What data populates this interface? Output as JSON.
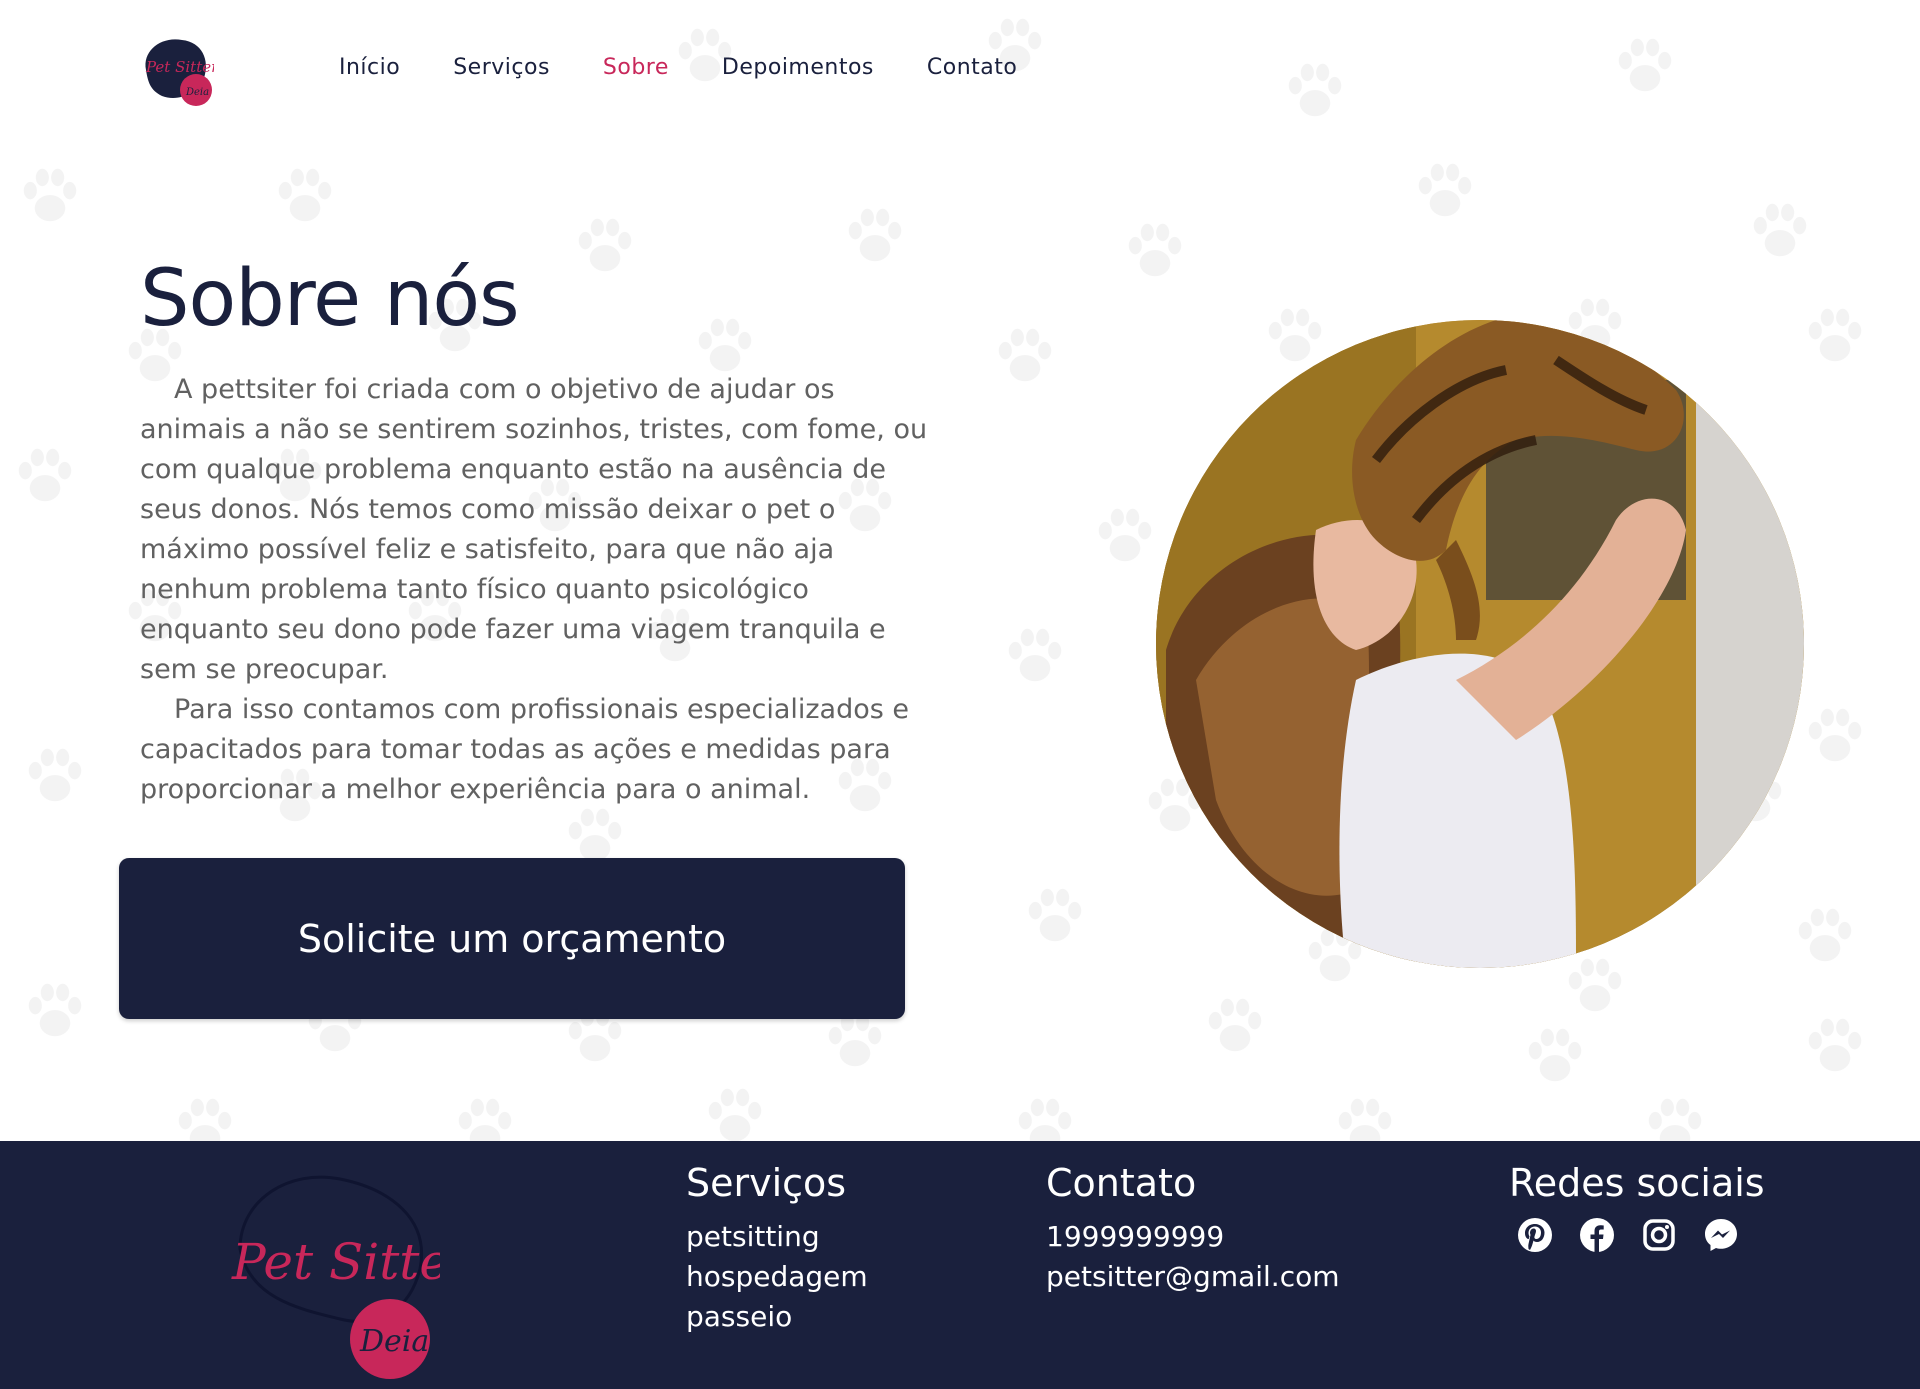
{
  "brand": {
    "logo_text_main": "Pet Sitter",
    "logo_text_sub": "Deia"
  },
  "nav": {
    "items": [
      {
        "label": "Início",
        "active": false
      },
      {
        "label": "Serviços",
        "active": false
      },
      {
        "label": "Sobre",
        "active": true
      },
      {
        "label": "Depoimentos",
        "active": false
      },
      {
        "label": "Contato",
        "active": false
      }
    ]
  },
  "about": {
    "title": "Sobre nós",
    "paragraph_1": "A pettsiter foi criada com o objetivo de ajudar os animais a não se sentirem sozinhos, tristes, com fome, ou com qualque problema enquanto estão na ausência de seus donos. Nós temos como missão deixar o pet o máximo possível feliz e satisfeito, para que não aja nenhum problema tanto físico quanto psicológico enquanto seu dono pode fazer uma viagem tranquila e sem se preocupar.",
    "paragraph_2": "Para isso contamos com profissionais especializados e capacitados para tomar todas as ações e medidas para proporcionar a melhor experiência para o animal.",
    "cta_label": "Solicite um orçamento",
    "photo_icon": "woman-kissing-cat-photo"
  },
  "footer": {
    "servicos": {
      "title": "Serviços",
      "items": [
        "petsitting",
        "hospedagem",
        "passeio"
      ]
    },
    "contato": {
      "title": "Contato",
      "phone": "1999999999",
      "email": "petsitter@gmail.com"
    },
    "redes": {
      "title": "Redes sociais",
      "icons": [
        "pinterest-icon",
        "facebook-icon",
        "instagram-icon",
        "messenger-icon"
      ]
    }
  },
  "colors": {
    "navy": "#1a203d",
    "accent": "#c8275a",
    "text_gray": "#616161",
    "white": "#ffffff"
  }
}
